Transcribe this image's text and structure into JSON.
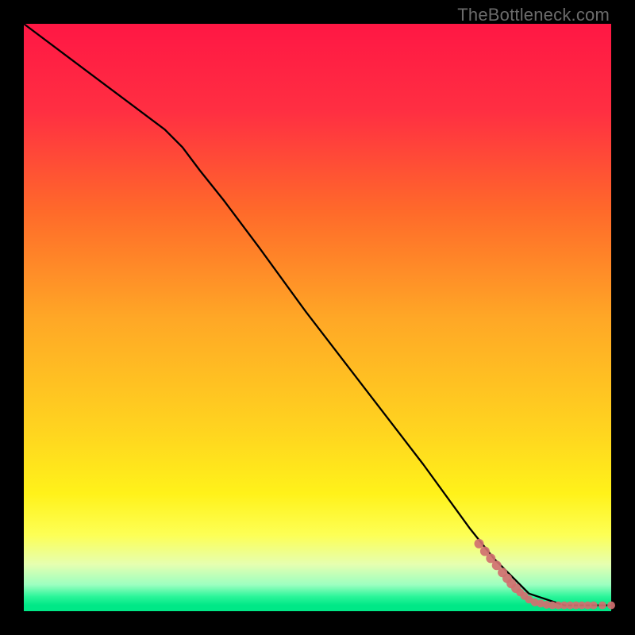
{
  "watermark": "TheBottleneck.com",
  "chart_data": {
    "type": "line",
    "title": "",
    "xlabel": "",
    "ylabel": "",
    "xlim": [
      0,
      100
    ],
    "ylim": [
      0,
      100
    ],
    "background_gradient": {
      "stops": [
        {
          "offset": 0.0,
          "color": "#ff1744"
        },
        {
          "offset": 0.15,
          "color": "#ff2f42"
        },
        {
          "offset": 0.32,
          "color": "#ff6a2a"
        },
        {
          "offset": 0.5,
          "color": "#ffa726"
        },
        {
          "offset": 0.7,
          "color": "#ffd61f"
        },
        {
          "offset": 0.8,
          "color": "#fff21a"
        },
        {
          "offset": 0.87,
          "color": "#fdff55"
        },
        {
          "offset": 0.92,
          "color": "#e6ffb0"
        },
        {
          "offset": 0.955,
          "color": "#9cffc0"
        },
        {
          "offset": 0.975,
          "color": "#2cf59a"
        },
        {
          "offset": 0.99,
          "color": "#00e887"
        },
        {
          "offset": 1.0,
          "color": "#00e887"
        }
      ]
    },
    "series": [
      {
        "name": "bottleneck-curve",
        "x": [
          0,
          8,
          16,
          24,
          27,
          30,
          34,
          40,
          48,
          58,
          68,
          76,
          80,
          82,
          84,
          86,
          89,
          92,
          95,
          98,
          100
        ],
        "y": [
          100,
          94,
          88,
          82,
          79,
          75,
          70,
          62,
          51,
          38,
          25,
          14,
          9,
          7,
          5,
          3,
          2,
          1,
          1,
          1,
          1
        ]
      }
    ],
    "dots": {
      "name": "run-markers",
      "points": [
        {
          "x": 77.5,
          "y": 11.5,
          "r": 6
        },
        {
          "x": 78.5,
          "y": 10.2,
          "r": 6
        },
        {
          "x": 79.5,
          "y": 9.0,
          "r": 6
        },
        {
          "x": 80.5,
          "y": 7.8,
          "r": 6
        },
        {
          "x": 81.5,
          "y": 6.6,
          "r": 6
        },
        {
          "x": 82.3,
          "y": 5.6,
          "r": 6
        },
        {
          "x": 83.0,
          "y": 4.7,
          "r": 6
        },
        {
          "x": 83.8,
          "y": 3.9,
          "r": 6
        },
        {
          "x": 84.5,
          "y": 3.2,
          "r": 5
        },
        {
          "x": 85.2,
          "y": 2.6,
          "r": 5
        },
        {
          "x": 86.0,
          "y": 2.0,
          "r": 5
        },
        {
          "x": 87.0,
          "y": 1.5,
          "r": 5
        },
        {
          "x": 88.0,
          "y": 1.3,
          "r": 5
        },
        {
          "x": 89.0,
          "y": 1.1,
          "r": 5
        },
        {
          "x": 90.0,
          "y": 1.0,
          "r": 5
        },
        {
          "x": 91.0,
          "y": 1.0,
          "r": 5
        },
        {
          "x": 92.0,
          "y": 1.0,
          "r": 5
        },
        {
          "x": 93.0,
          "y": 1.0,
          "r": 5
        },
        {
          "x": 94.0,
          "y": 1.0,
          "r": 5
        },
        {
          "x": 95.0,
          "y": 1.0,
          "r": 5
        },
        {
          "x": 96.0,
          "y": 1.0,
          "r": 5
        },
        {
          "x": 97.0,
          "y": 1.0,
          "r": 5
        },
        {
          "x": 98.5,
          "y": 1.0,
          "r": 5
        },
        {
          "x": 100.0,
          "y": 1.0,
          "r": 5
        }
      ]
    }
  }
}
